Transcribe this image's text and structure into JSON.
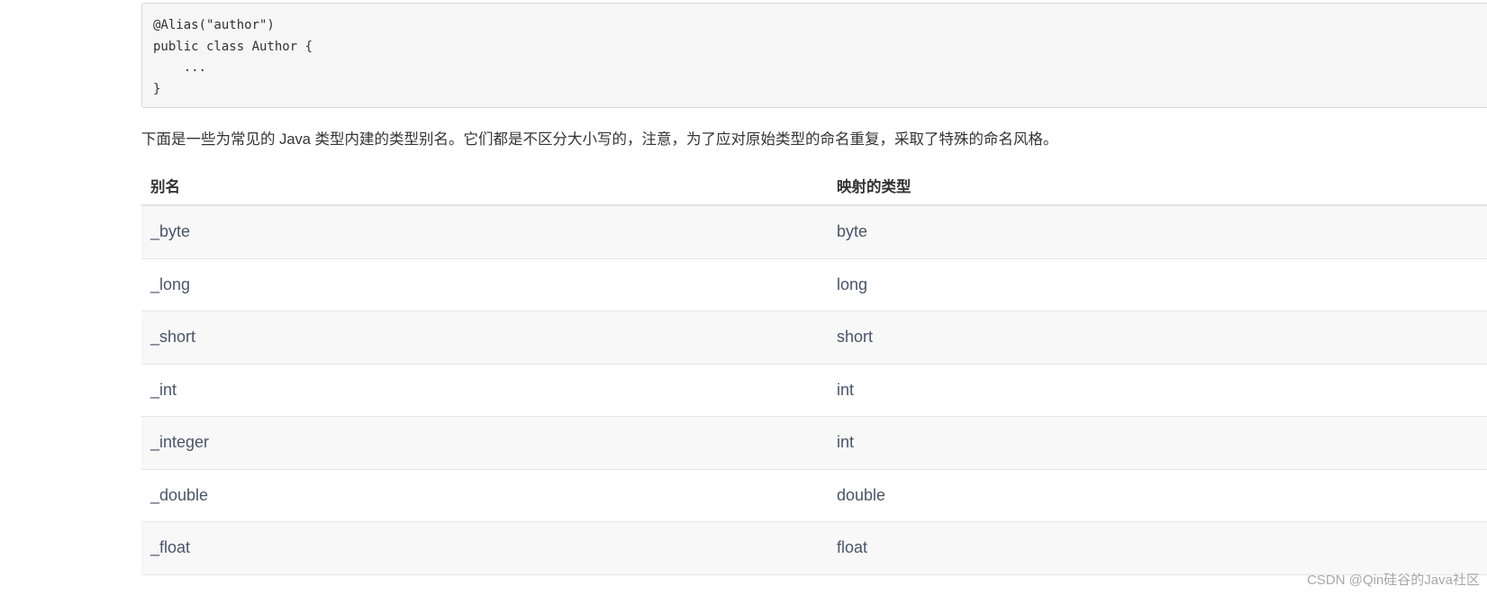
{
  "code_block": {
    "lines": [
      "@Alias(\"author\")",
      "public class Author {",
      "    ...",
      "}"
    ]
  },
  "paragraph": "下面是一些为常见的 Java 类型内建的类型别名。它们都是不区分大小写的，注意，为了应对原始类型的命名重复，采取了特殊的命名风格。",
  "table": {
    "headers": [
      "别名",
      "映射的类型"
    ],
    "rows": [
      [
        "_byte",
        "byte"
      ],
      [
        "_long",
        "long"
      ],
      [
        "_short",
        "short"
      ],
      [
        "_int",
        "int"
      ],
      [
        "_integer",
        "int"
      ],
      [
        "_double",
        "double"
      ],
      [
        "_float",
        "float"
      ]
    ]
  },
  "watermark": "CSDN @Qin硅谷的Java社区"
}
